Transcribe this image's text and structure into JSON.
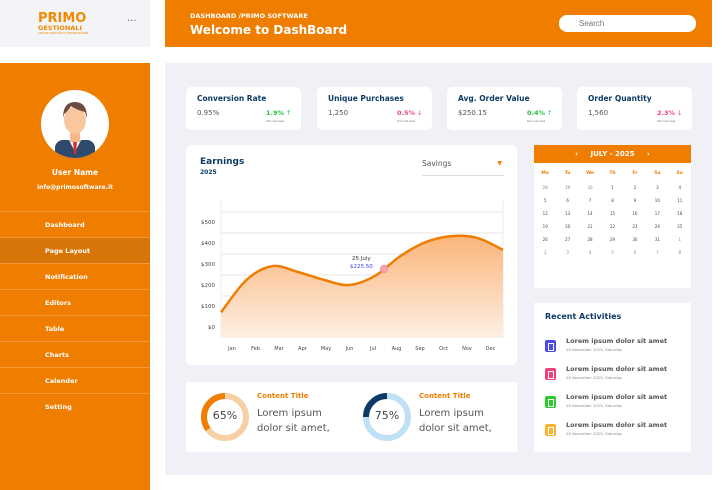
{
  "logo": {
    "name": "PRIMO",
    "sub": "GESTIONALI",
    "tagline": "carica scarica e personalizza"
  },
  "menu_icon": "more-dots",
  "header": {
    "breadcrumb": "DASHBOARD /PRIMO SOFTWARE",
    "title": "Welcome to DashBoard",
    "search_placeholder": "Search"
  },
  "user": {
    "name": "User Name",
    "email": "info@primosoftware.it"
  },
  "sidebar": {
    "items": [
      {
        "label": "Dashboard"
      },
      {
        "label": "Page Layout",
        "active": true
      },
      {
        "label": "Notification"
      },
      {
        "label": "Editors"
      },
      {
        "label": "Table"
      },
      {
        "label": "Charts"
      },
      {
        "label": "Calender"
      },
      {
        "label": "Setting"
      }
    ]
  },
  "kpis": [
    {
      "title": "Conversion Rate",
      "value": "0.95%",
      "change": "1.9%",
      "dir": "up",
      "sub": "than last week",
      "color": "#22c33a"
    },
    {
      "title": "Unique Purchases",
      "value": "1,250",
      "change": "0.5%",
      "dir": "down",
      "sub": "than last week",
      "color": "#f0457e"
    },
    {
      "title": "Avg. Order Value",
      "value": "$250.15",
      "change": "0.4%",
      "dir": "up",
      "sub": "than last week",
      "color": "#22c33a"
    },
    {
      "title": "Order Quantity",
      "value": "1,560",
      "change": "2.3%",
      "dir": "down",
      "sub": "than last week",
      "color": "#f0457e"
    }
  ],
  "earnings": {
    "title": "Earnings",
    "year": "2025",
    "dropdown": "Savings",
    "tooltip_date": "25 July",
    "tooltip_value": "$225.50"
  },
  "chart_data": {
    "type": "area",
    "categories": [
      "Jan",
      "Feb",
      "Mar",
      "Apr",
      "May",
      "Jun",
      "Jul",
      "Aug",
      "Sep",
      "Oct",
      "Nov",
      "Dec"
    ],
    "values": [
      70,
      225,
      290,
      262,
      225,
      200,
      243,
      338,
      405,
      433,
      424,
      367
    ],
    "yticks": [
      "$500",
      "$400",
      "$300",
      "$200",
      "$100",
      "$0"
    ],
    "ylim": [
      0,
      500
    ],
    "grid": true,
    "color": "#ee7d00"
  },
  "calendar": {
    "title": "JULY - 2025",
    "weekdays": [
      "Mo",
      "Tu",
      "We",
      "Th",
      "Fr",
      "Sa",
      "Su"
    ],
    "days": [
      "28",
      "29",
      "30",
      "1",
      "2",
      "3",
      "4",
      "5",
      "6",
      "7",
      "8",
      "9",
      "10",
      "11",
      "12",
      "13",
      "14",
      "15",
      "16",
      "17",
      "18",
      "19",
      "20",
      "21",
      "22",
      "23",
      "24",
      "25",
      "26",
      "27",
      "28",
      "29",
      "30",
      "31",
      "1",
      "2",
      "3",
      "4",
      "5",
      "6",
      "7",
      "8"
    ]
  },
  "activities": {
    "title": "Recent Activities",
    "items": [
      {
        "text": "Lorem ipsum dolor sit amet",
        "date": "26 November 2025, Saturday",
        "color": "#4a4ae8"
      },
      {
        "text": "Lorem ipsum dolor sit amet",
        "date": "26 November 2025, Saturday",
        "color": "#f0407c"
      },
      {
        "text": "Lorem ipsum dolor sit amet",
        "date": "26 November 2025, Saturday",
        "color": "#2ccc2c"
      },
      {
        "text": "Lorem ipsum dolor sit amet",
        "date": "26 November 2025, Saturday",
        "color": "#fbb231"
      }
    ]
  },
  "progress": [
    {
      "percent": 65,
      "label": "65%",
      "title": "Content Title",
      "text": "Lorem ipsum dolor sit amet,",
      "color": "#ee7d00",
      "track": "#f6cfa5"
    },
    {
      "percent": 75,
      "label": "75%",
      "title": "Content Title",
      "text": "Lorem ipsum dolor sit amet,",
      "color": "#0d3b66",
      "track": "#bfe0f5"
    }
  ]
}
